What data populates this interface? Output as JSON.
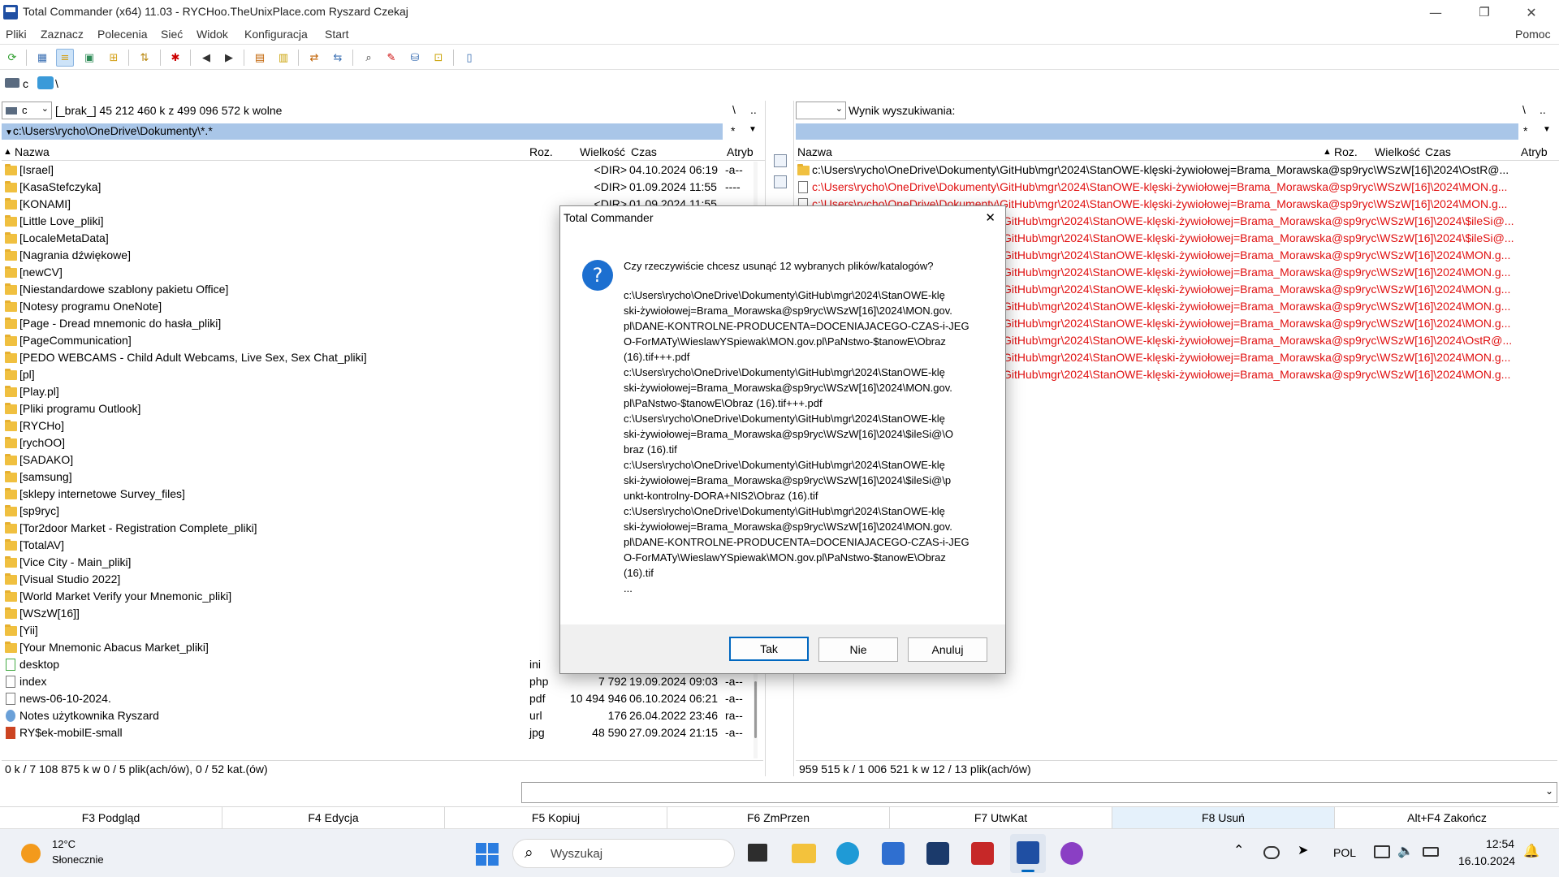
{
  "window": {
    "title": "Total Commander (x64) 11.03 - RYCHoo.TheUnixPlace.com Ryszard Czekaj",
    "minimize": "—",
    "maximize": "❐",
    "close": "✕"
  },
  "menu": {
    "items": [
      "Pliki",
      "Zaznacz",
      "Polecenia",
      "Sieć",
      "Widok",
      "Konfiguracja",
      "Start"
    ],
    "help": "Pomoc"
  },
  "drivebar": {
    "drive_label": "c",
    "root": "\\"
  },
  "left_panel": {
    "drive": "c",
    "drive_info": "[_brak_]  45 212 460 k z 499 096 572 k wolne",
    "root_btn": "\\",
    "up_btn": "..",
    "path": "c:\\Users\\rycho\\OneDrive\\Dokumenty\\*.*",
    "star": "*",
    "columns": {
      "name": "Nazwa",
      "ext": "Roz.",
      "size": "Wielkość",
      "date": "Czas",
      "attr": "Atryb"
    },
    "rows": [
      {
        "name": "[Israel]",
        "ext": "",
        "size": "<DIR>",
        "date": "04.10.2024 06:19",
        "attr": "-a--",
        "type": "folder"
      },
      {
        "name": "[KasaStefczyka]",
        "ext": "",
        "size": "<DIR>",
        "date": "01.09.2024 11:55",
        "attr": "----",
        "type": "folder"
      },
      {
        "name": "[KONAMI]",
        "ext": "",
        "size": "<DIR>",
        "date": "01.09.2024 11:55",
        "attr": "",
        "type": "folder"
      },
      {
        "name": "[Little Love_pliki]",
        "ext": "",
        "size": "",
        "date": "",
        "attr": "",
        "type": "folder"
      },
      {
        "name": "[LocaleMetaData]",
        "ext": "",
        "size": "",
        "date": "",
        "attr": "",
        "type": "folder"
      },
      {
        "name": "[Nagrania dźwiękowe]",
        "ext": "",
        "size": "",
        "date": "",
        "attr": "",
        "type": "folder"
      },
      {
        "name": "[newCV]",
        "ext": "",
        "size": "",
        "date": "",
        "attr": "",
        "type": "folder"
      },
      {
        "name": "[Niestandardowe szablony pakietu Office]",
        "ext": "",
        "size": "",
        "date": "",
        "attr": "",
        "type": "folder"
      },
      {
        "name": "[Notesy programu OneNote]",
        "ext": "",
        "size": "",
        "date": "",
        "attr": "",
        "type": "folder"
      },
      {
        "name": "[Page - Dread mnemonic do hasła_pliki]",
        "ext": "",
        "size": "",
        "date": "",
        "attr": "",
        "type": "folder"
      },
      {
        "name": "[PageCommunication]",
        "ext": "",
        "size": "",
        "date": "",
        "attr": "",
        "type": "folder"
      },
      {
        "name": "[PEDO WEBCAMS - Child Adult Webcams, Live Sex, Sex Chat_pliki]",
        "ext": "",
        "size": "",
        "date": "",
        "attr": "",
        "type": "folder"
      },
      {
        "name": "[pl]",
        "ext": "",
        "size": "",
        "date": "",
        "attr": "",
        "type": "folder"
      },
      {
        "name": "[Play.pl]",
        "ext": "",
        "size": "",
        "date": "",
        "attr": "",
        "type": "folder"
      },
      {
        "name": "[Pliki programu Outlook]",
        "ext": "",
        "size": "",
        "date": "",
        "attr": "",
        "type": "folder"
      },
      {
        "name": "[RYCHo]",
        "ext": "",
        "size": "",
        "date": "",
        "attr": "",
        "type": "folder"
      },
      {
        "name": "[rychOO]",
        "ext": "",
        "size": "",
        "date": "",
        "attr": "",
        "type": "folder"
      },
      {
        "name": "[SADAKO]",
        "ext": "",
        "size": "",
        "date": "",
        "attr": "",
        "type": "folder"
      },
      {
        "name": "[samsung]",
        "ext": "",
        "size": "",
        "date": "",
        "attr": "",
        "type": "folder"
      },
      {
        "name": "[sklepy internetowe Survey_files]",
        "ext": "",
        "size": "",
        "date": "",
        "attr": "",
        "type": "folder"
      },
      {
        "name": "[sp9ryc]",
        "ext": "",
        "size": "",
        "date": "",
        "attr": "",
        "type": "folder"
      },
      {
        "name": "[Tor2door Market - Registration Complete_pliki]",
        "ext": "",
        "size": "",
        "date": "",
        "attr": "",
        "type": "folder"
      },
      {
        "name": "[TotalAV]",
        "ext": "",
        "size": "",
        "date": "",
        "attr": "",
        "type": "folder"
      },
      {
        "name": "[Vice City - Main_pliki]",
        "ext": "",
        "size": "",
        "date": "",
        "attr": "",
        "type": "folder"
      },
      {
        "name": "[Visual Studio 2022]",
        "ext": "",
        "size": "",
        "date": "",
        "attr": "",
        "type": "folder"
      },
      {
        "name": "[World Market Verify your Mnemonic_pliki]",
        "ext": "",
        "size": "",
        "date": "",
        "attr": "",
        "type": "folder"
      },
      {
        "name": "[WSzW[16]]",
        "ext": "",
        "size": "7",
        "date": "",
        "attr": "",
        "type": "folder"
      },
      {
        "name": "[Yii]",
        "ext": "",
        "size": "",
        "date": "",
        "attr": "",
        "type": "folder"
      },
      {
        "name": "[Your Mnemonic Abacus Market_pliki]",
        "ext": "",
        "size": "",
        "date": "",
        "attr": "",
        "type": "folder"
      },
      {
        "name": "desktop",
        "ext": "ini",
        "size": "",
        "date": "",
        "attr": "",
        "type": "ini"
      },
      {
        "name": "index",
        "ext": "php",
        "size": "7 792",
        "date": "19.09.2024 09:03",
        "attr": "-a--",
        "type": "file"
      },
      {
        "name": "news-06-10-2024.",
        "ext": "pdf",
        "size": "10 494 946",
        "date": "06.10.2024 06:21",
        "attr": "-a--",
        "type": "file"
      },
      {
        "name": "Notes użytkownika Ryszard",
        "ext": "url",
        "size": "176",
        "date": "26.04.2022 23:46",
        "attr": "ra--",
        "type": "url"
      },
      {
        "name": "RY$ek-mobilE-small",
        "ext": "jpg",
        "size": "48 590",
        "date": "27.09.2024 21:15",
        "attr": "-a--",
        "type": "jpg"
      }
    ],
    "status": "0 k / 7 108 875 k w 0 / 5 plik(ach/ów), 0 / 52 kat.(ów)"
  },
  "right_panel": {
    "drive": "",
    "search_label": "Wynik wyszukiwania:",
    "root_btn": "\\",
    "up_btn": "..",
    "star": "*",
    "columns": {
      "name": "Nazwa",
      "ext": "Roz.",
      "size": "Wielkość",
      "date": "Czas",
      "attr": "Atryb"
    },
    "rows": [
      {
        "name": "c:\\Users\\rycho\\OneDrive\\Dokumenty\\GitHub\\mgr\\2024\\StanOWE-klęski-żywiołowej=Brama_Morawska@sp9ryc\\WSzW[16]\\2024\\OstR@...",
        "red": false,
        "folder": true
      },
      {
        "name": "c:\\Users\\rycho\\OneDrive\\Dokumenty\\GitHub\\mgr\\2024\\StanOWE-klęski-żywiołowej=Brama_Morawska@sp9ryc\\WSzW[16]\\2024\\MON.g...",
        "red": true,
        "folder": false
      },
      {
        "name": "c:\\Users\\rycho\\OneDrive\\Dokumenty\\GitHub\\mgr\\2024\\StanOWE-klęski-żywiołowej=Brama_Morawska@sp9ryc\\WSzW[16]\\2024\\MON.g...",
        "red": true,
        "folder": false
      },
      {
        "name": "GitHub\\mgr\\2024\\StanOWE-klęski-żywiołowej=Brama_Morawska@sp9ryc\\WSzW[16]\\2024\\$ileSi@...",
        "red": true,
        "folder": false
      },
      {
        "name": "GitHub\\mgr\\2024\\StanOWE-klęski-żywiołowej=Brama_Morawska@sp9ryc\\WSzW[16]\\2024\\$ileSi@...",
        "red": true,
        "folder": false
      },
      {
        "name": "GitHub\\mgr\\2024\\StanOWE-klęski-żywiołowej=Brama_Morawska@sp9ryc\\WSzW[16]\\2024\\MON.g...",
        "red": true,
        "folder": false
      },
      {
        "name": "GitHub\\mgr\\2024\\StanOWE-klęski-żywiołowej=Brama_Morawska@sp9ryc\\WSzW[16]\\2024\\MON.g...",
        "red": true,
        "folder": false
      },
      {
        "name": "GitHub\\mgr\\2024\\StanOWE-klęski-żywiołowej=Brama_Morawska@sp9ryc\\WSzW[16]\\2024\\MON.g...",
        "red": true,
        "folder": false
      },
      {
        "name": "GitHub\\mgr\\2024\\StanOWE-klęski-żywiołowej=Brama_Morawska@sp9ryc\\WSzW[16]\\2024\\MON.g...",
        "red": true,
        "folder": false
      },
      {
        "name": "GitHub\\mgr\\2024\\StanOWE-klęski-żywiołowej=Brama_Morawska@sp9ryc\\WSzW[16]\\2024\\MON.g...",
        "red": true,
        "folder": false
      },
      {
        "name": "GitHub\\mgr\\2024\\StanOWE-klęski-żywiołowej=Brama_Morawska@sp9ryc\\WSzW[16]\\2024\\OstR@...",
        "red": true,
        "folder": false
      },
      {
        "name": "GitHub\\mgr\\2024\\StanOWE-klęski-żywiołowej=Brama_Morawska@sp9ryc\\WSzW[16]\\2024\\MON.g...",
        "red": true,
        "folder": false
      },
      {
        "name": "GitHub\\mgr\\2024\\StanOWE-klęski-żywiołowej=Brama_Morawska@sp9ryc\\WSzW[16]\\2024\\MON.g...",
        "red": true,
        "folder": false
      }
    ],
    "status": "959 515 k / 1 006 521 k w 12 / 13 plik(ach/ów)"
  },
  "fkeys": [
    "F3 Podgląd",
    "F4 Edycja",
    "F5 Kopiuj",
    "F6 ZmPrzen",
    "F7 UtwKat",
    "F8 Usuń",
    "Alt+F4 Zakończ"
  ],
  "dialog": {
    "title": "Total Commander",
    "close": "✕",
    "question": "Czy rzeczywiście chcesz usunąć 12 wybranych plików/katalogów?",
    "lines": [
      "c:\\Users\\rycho\\OneDrive\\Dokumenty\\GitHub\\mgr\\2024\\StanOWE-klę",
      "ski-żywiołowej=Brama_Morawska@sp9ryc\\WSzW[16]\\2024\\MON.gov.",
      "pl\\DANE-KONTROLNE-PRODUCENTA=DOCENIAJACEGO-CZAS-i-JEG",
      "O-ForMATy\\WieslawYSpiewak\\MON.gov.pl\\PaNstwo-$tanowE\\Obraz",
      "(16).tif+++.pdf",
      "c:\\Users\\rycho\\OneDrive\\Dokumenty\\GitHub\\mgr\\2024\\StanOWE-klę",
      "ski-żywiołowej=Brama_Morawska@sp9ryc\\WSzW[16]\\2024\\MON.gov.",
      "pl\\PaNstwo-$tanowE\\Obraz (16).tif+++.pdf",
      "c:\\Users\\rycho\\OneDrive\\Dokumenty\\GitHub\\mgr\\2024\\StanOWE-klę",
      "ski-żywiołowej=Brama_Morawska@sp9ryc\\WSzW[16]\\2024\\$ileSi@\\O",
      "braz (16).tif",
      "c:\\Users\\rycho\\OneDrive\\Dokumenty\\GitHub\\mgr\\2024\\StanOWE-klę",
      "ski-żywiołowej=Brama_Morawska@sp9ryc\\WSzW[16]\\2024\\$ileSi@\\p",
      "unkt-kontrolny-DORA+NIS2\\Obraz (16).tif",
      "c:\\Users\\rycho\\OneDrive\\Dokumenty\\GitHub\\mgr\\2024\\StanOWE-klę",
      "ski-żywiołowej=Brama_Morawska@sp9ryc\\WSzW[16]\\2024\\MON.gov.",
      "pl\\DANE-KONTROLNE-PRODUCENTA=DOCENIAJACEGO-CZAS-i-JEG",
      "O-ForMATy\\WieslawYSpiewak\\MON.gov.pl\\PaNstwo-$tanowE\\Obraz",
      "(16).tif",
      "..."
    ],
    "yes": "Tak",
    "no": "Nie",
    "cancel": "Anuluj"
  },
  "taskbar": {
    "weather_temp": "12°C",
    "weather_desc": "Słonecznie",
    "search_placeholder": "Wyszukaj",
    "lang": "POL",
    "time": "12:54",
    "date": "16.10.2024"
  },
  "colors": {
    "path_bar": "#a9c6e8",
    "red_text": "#e01010",
    "accent": "#0067c0",
    "folder": "#f0c040"
  }
}
